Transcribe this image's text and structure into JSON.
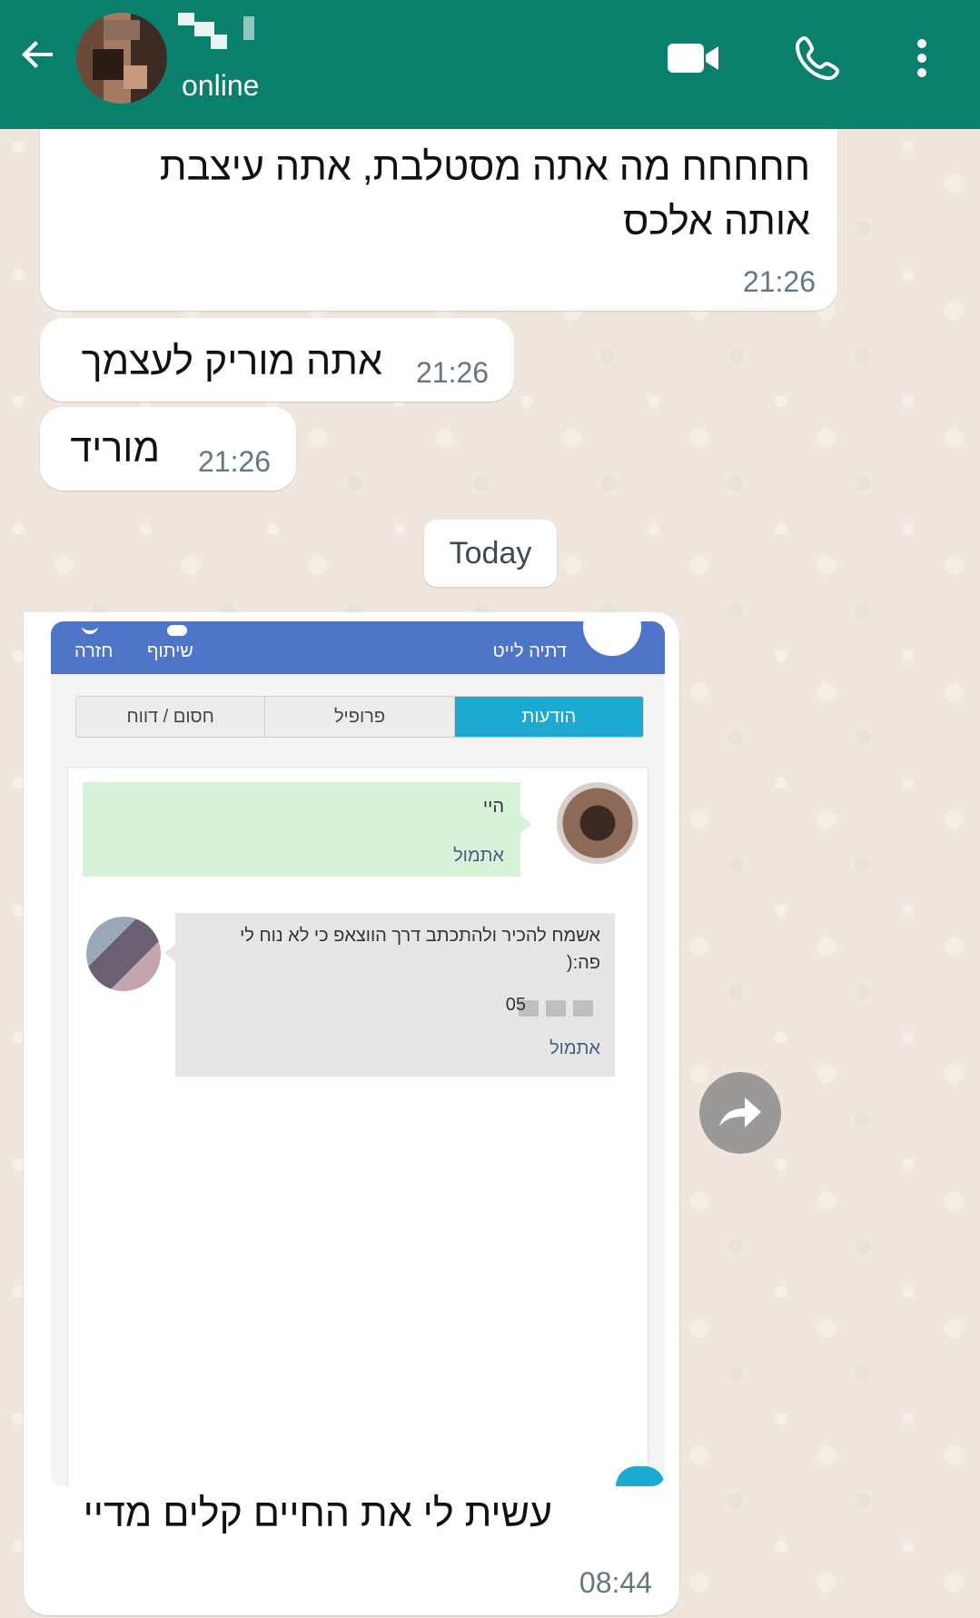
{
  "header": {
    "status": "online",
    "bg_color": "#0a7f6c"
  },
  "messages": [
    {
      "text": "חחחחח מה אתה מסטלבת, אתה עיצבת אותה אלכס",
      "time": "21:26"
    },
    {
      "text": "אתה מוריק לעצמך",
      "time": "21:26"
    },
    {
      "text": "מוריד",
      "time": "21:26"
    }
  ],
  "date_chip": "Today",
  "image_message": {
    "caption": "עשית לי את החיים קלים מדיי",
    "time": "08:44",
    "screenshot": {
      "top_bar": {
        "name": "דתיה לייט",
        "share_label": "שיתוף",
        "back_label": "חזרה"
      },
      "tabs": [
        "הודעות",
        "פרופיל",
        "חסום / דווח"
      ],
      "messages": [
        {
          "text": "היי",
          "date": "אתמול"
        },
        {
          "text": "אשמח להכיר ולהתכתב דרך הווצאפ כי לא נוח לי פה:(",
          "phone_prefix": "05",
          "date": "אתמול"
        }
      ]
    }
  }
}
